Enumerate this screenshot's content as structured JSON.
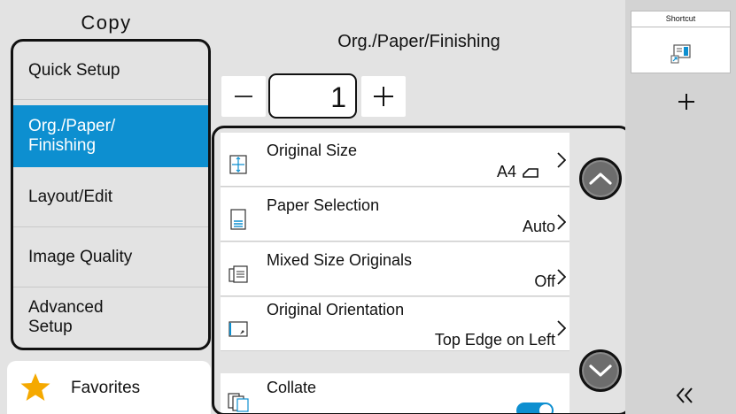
{
  "left_panel": {
    "title": "Copy",
    "menu": [
      {
        "label": "Quick Setup",
        "active": false
      },
      {
        "label": "Org./Paper/\nFinishing",
        "active": true
      },
      {
        "label": "Layout/Edit",
        "active": false
      },
      {
        "label": "Image Quality",
        "active": false
      },
      {
        "label": "Advanced\nSetup",
        "active": false
      }
    ],
    "favorites_label": "Favorites",
    "favorites_icon": "star-icon"
  },
  "header": {
    "title": "Org./Paper/Finishing"
  },
  "copies": {
    "value": "1",
    "minus_icon": "minus-icon",
    "plus_icon": "plus-icon"
  },
  "settings": [
    {
      "title": "Original Size",
      "value": "A4",
      "icon": "original-size-icon",
      "extra": "orientation-glyph"
    },
    {
      "title": "Paper Selection",
      "value": "Auto",
      "icon": "paper-selection-icon"
    },
    {
      "title": "Mixed Size Originals",
      "value": "Off",
      "icon": "mixed-size-icon"
    },
    {
      "title": "Original Orientation",
      "value": "Top Edge on Left",
      "icon": "orientation-icon"
    },
    {
      "title": "Collate",
      "value": "",
      "icon": "collate-icon",
      "toggle": true
    }
  ],
  "scroll": {
    "up_icon": "chevron-up-icon",
    "down_icon": "chevron-down-icon"
  },
  "right_rail": {
    "shortcut_label": "Shortcut",
    "shortcut_icon": "shortcut-icon",
    "add_icon": "plus-icon",
    "collapse_icon": "double-chevron-left-icon"
  },
  "colors": {
    "accent": "#0d8fd0",
    "panel_bg": "#e3e3e3",
    "rail_bg": "#d3d3d3",
    "scroll_btn": "#6d6d6d"
  }
}
